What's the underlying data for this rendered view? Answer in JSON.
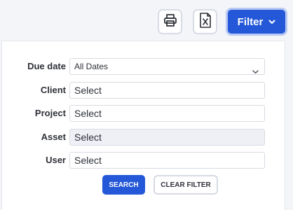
{
  "toolbar": {
    "print_icon": "printer-icon",
    "excel_icon": "excel-export-icon",
    "filter_label": "Filter",
    "filter_chevron": "chevron-down-icon",
    "accent_color": "#2458d8"
  },
  "filter_panel": {
    "fields": [
      {
        "label": "Due date",
        "value": "All Dates",
        "type": "select"
      },
      {
        "label": "Client",
        "value": "Select",
        "type": "input"
      },
      {
        "label": "Project",
        "value": "Select",
        "type": "input"
      },
      {
        "label": "Asset",
        "value": "Select",
        "type": "input",
        "disabled": true
      },
      {
        "label": "User",
        "value": "Select",
        "type": "input"
      }
    ],
    "search_label": "SEARCH",
    "clear_label": "CLEAR FILTER"
  }
}
